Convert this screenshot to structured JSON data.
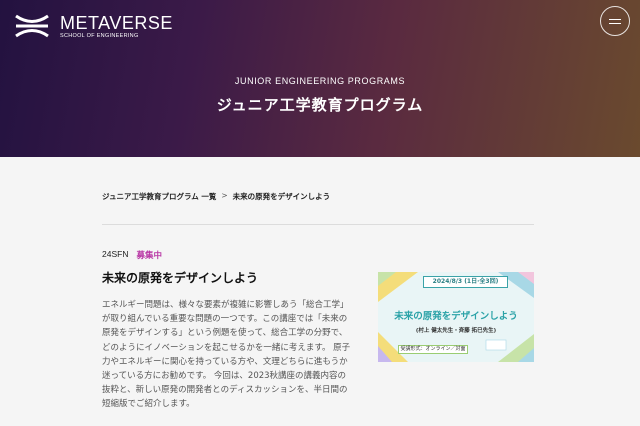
{
  "brand": {
    "title": "METAVERSE",
    "subtitle": "SCHOOL OF ENGINEERING"
  },
  "header": {
    "menu_icon": "menu-icon"
  },
  "hero": {
    "eyebrow": "JUNIOR ENGINEERING PROGRAMS",
    "title": "ジュニア工学教育プログラム"
  },
  "breadcrumb": {
    "items": [
      "ジュニア工学教育プログラム 一覧",
      "未来の原発をデザインしよう"
    ],
    "separator": ">"
  },
  "article": {
    "code": "24SFN",
    "status": "募集中",
    "status_color": "#b93aa6",
    "title": "未来の原発をデザインしよう",
    "description": "エネルギー問題は、様々な要素が複雑に影響しあう「総合工学」が取り組んでいる重要な問題の一つです。この講座では「未来の原発をデザインする」という例題を使って、総合工学の分野で、どのようにイノベーションを起こせるかを一緒に考えます。 原子力やエネルギーに関心を持っている方や、文理どちらに進もうか迷っている方にお勧めです。 今回は、2023秋講座の講義内容の抜粋と、新しい原発の開発者とのディスカッションを、半日間の短縮版でご紹介します。"
  },
  "banner": {
    "date": "2024/8/3 (1日·全3回)",
    "title": "未来の原発をデザインしよう",
    "speakers": "(村上 健太先生・斉藤 拓巳先生)",
    "format": "受講形式：オンライン／対面",
    "accent_color": "#2aa2a7"
  }
}
